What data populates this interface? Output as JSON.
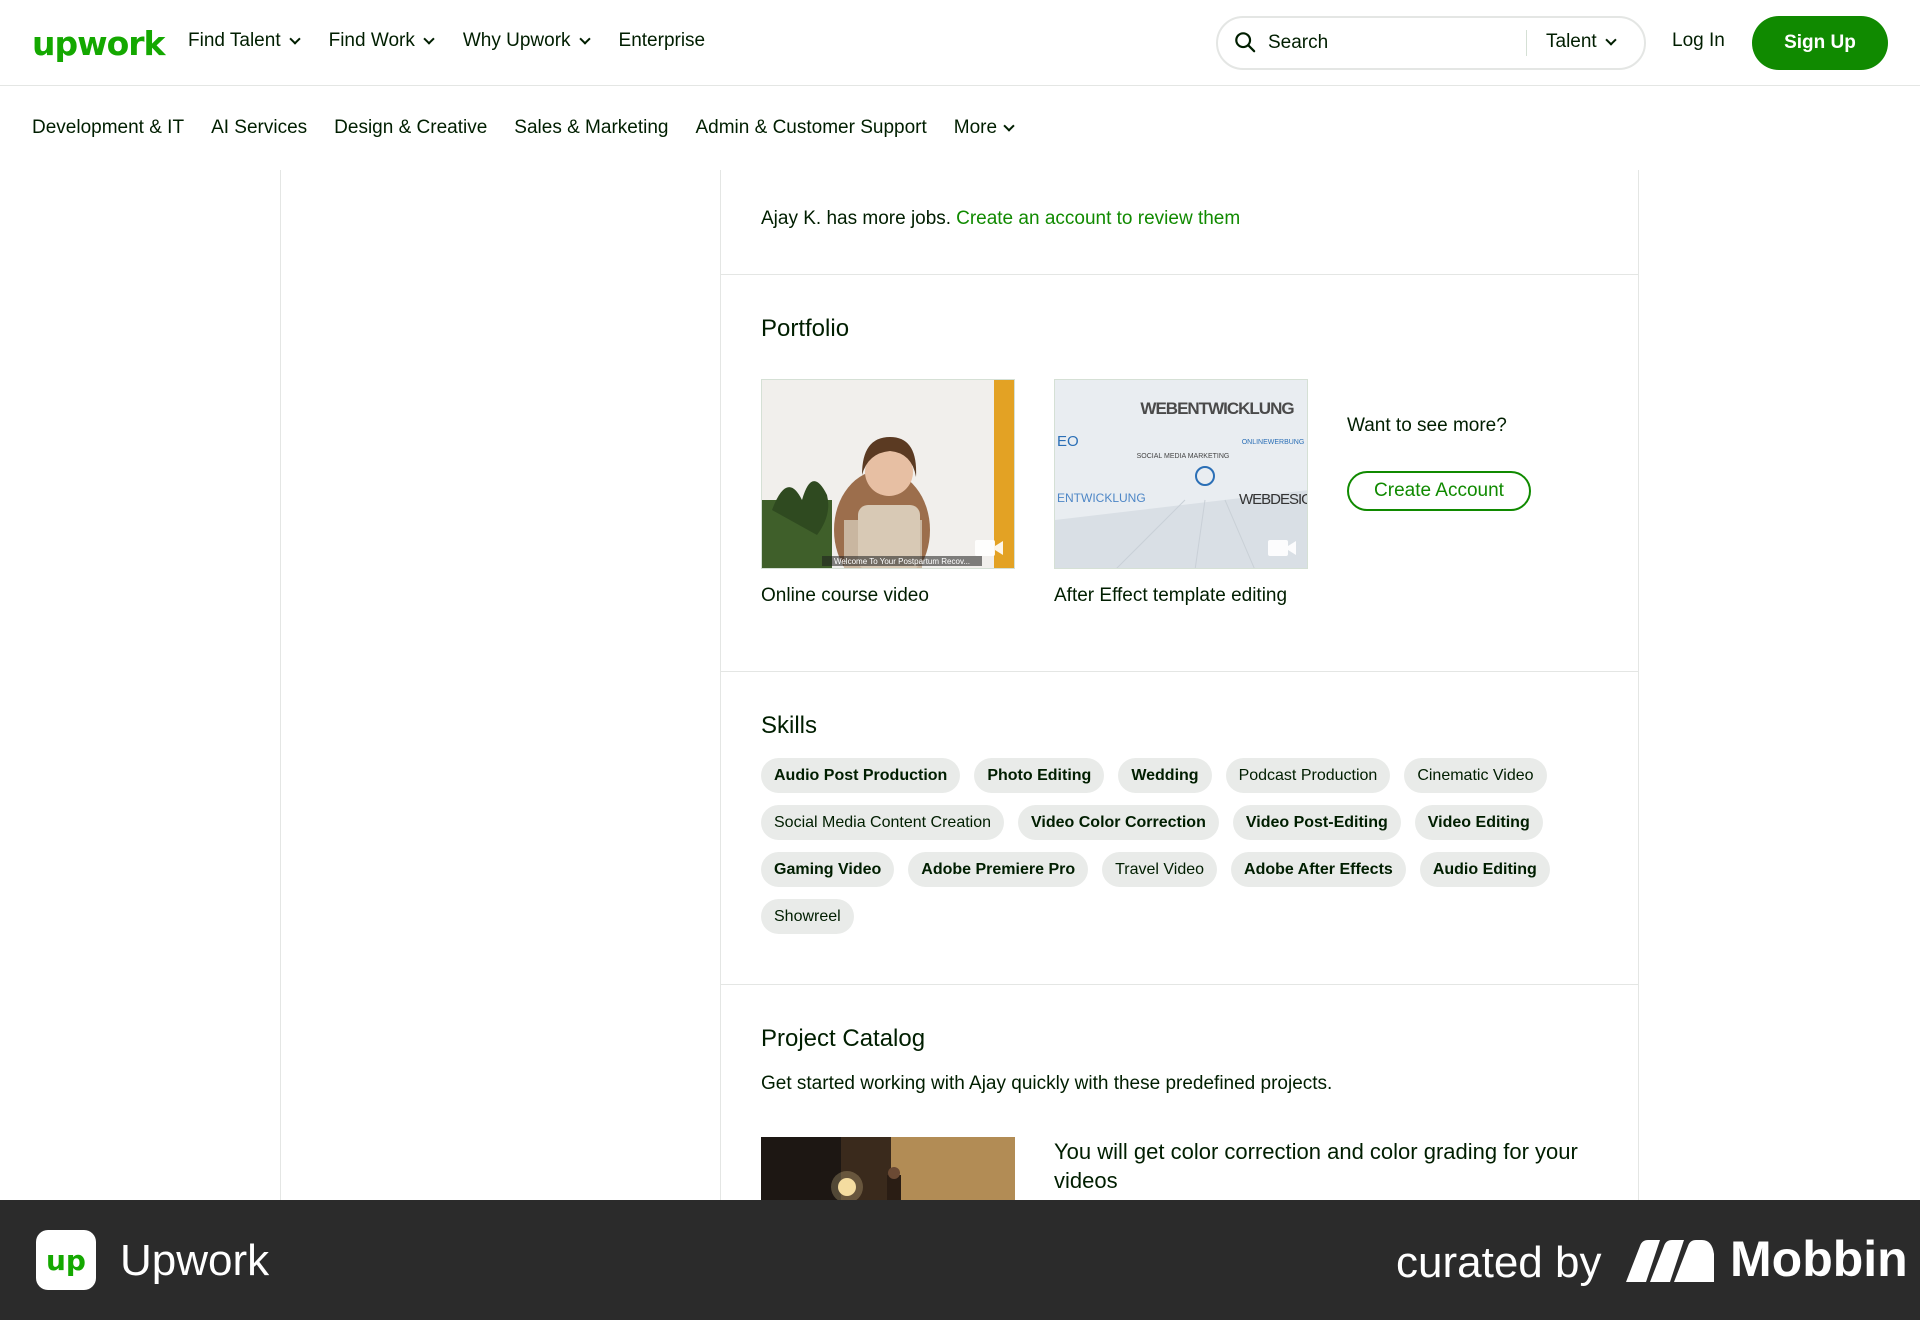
{
  "header": {
    "logo": "upwork",
    "nav": [
      {
        "label": "Find Talent",
        "dropdown": true
      },
      {
        "label": "Find Work",
        "dropdown": true
      },
      {
        "label": "Why Upwork",
        "dropdown": true
      },
      {
        "label": "Enterprise",
        "dropdown": false
      }
    ],
    "search_placeholder": "Search",
    "search_category": "Talent",
    "login": "Log In",
    "signup": "Sign Up"
  },
  "categories": [
    "Development & IT",
    "AI Services",
    "Design & Creative",
    "Sales & Marketing",
    "Admin & Customer Support"
  ],
  "categories_more": "More",
  "jobs": {
    "text": "Ajay K. has more jobs.",
    "link": "Create an account to review them"
  },
  "portfolio": {
    "title": "Portfolio",
    "items": [
      {
        "title": "Online course video",
        "caption": "Welcome To Your Postpartum Recov..."
      },
      {
        "title": "After Effect template editing",
        "words": [
          "WEBENTWICKLUNG",
          "EO",
          "ONLINEWERBUNG",
          "SOCIAL MEDIA MARKETING",
          "ENTWICKLUNG",
          "WEBDESIG"
        ]
      }
    ],
    "see_more": "Want to see more?",
    "create_account": "Create Account"
  },
  "skills": {
    "title": "Skills",
    "items": [
      {
        "label": "Audio Post Production",
        "bold": true
      },
      {
        "label": "Photo Editing",
        "bold": true
      },
      {
        "label": "Wedding",
        "bold": true
      },
      {
        "label": "Podcast Production",
        "bold": false
      },
      {
        "label": "Cinematic Video",
        "bold": false
      },
      {
        "label": "Social Media Content Creation",
        "bold": false
      },
      {
        "label": "Video Color Correction",
        "bold": true
      },
      {
        "label": "Video Post-Editing",
        "bold": true
      },
      {
        "label": "Video Editing",
        "bold": true
      },
      {
        "label": "Gaming Video",
        "bold": true
      },
      {
        "label": "Adobe Premiere Pro",
        "bold": true
      },
      {
        "label": "Travel Video",
        "bold": false
      },
      {
        "label": "Adobe After Effects",
        "bold": true
      },
      {
        "label": "Audio Editing",
        "bold": true
      },
      {
        "label": "Showreel",
        "bold": false
      }
    ]
  },
  "catalog": {
    "title": "Project Catalog",
    "subtitle": "Get started working with Ajay quickly with these predefined projects.",
    "project_title": "You will get color correction and color grading for your videos"
  },
  "banner": {
    "app_name": "Upwork",
    "app_icon": "up",
    "curated": "curated by",
    "brand": "Mobbin"
  },
  "colors": {
    "brand_green": "#14a800",
    "button_green": "#108a00",
    "banner_bg": "#2b2b2b"
  }
}
